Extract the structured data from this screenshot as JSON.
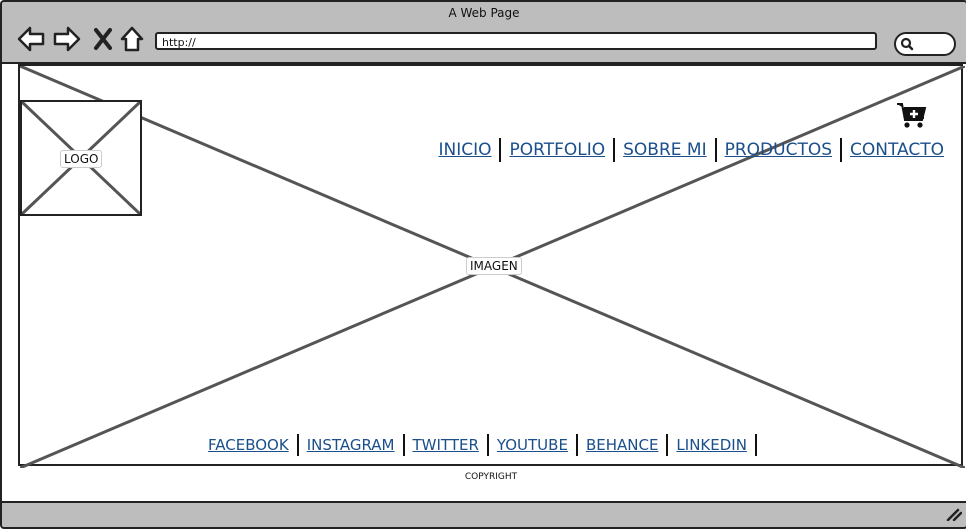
{
  "window": {
    "title": "A Web Page"
  },
  "toolbar": {
    "url": "http://",
    "back_icon": "back-arrow-icon",
    "forward_icon": "forward-arrow-icon",
    "stop_icon": "close-x-icon",
    "home_icon": "home-icon",
    "search_icon": "search-icon"
  },
  "page": {
    "logo_label": "LOGO",
    "hero_label": "IMAGEN",
    "cart_icon": "add-to-cart-icon",
    "nav": [
      "INICIO",
      "PORTFOLIO",
      "SOBRE MI",
      "PRODUCTOS",
      "CONTACTO"
    ],
    "social": [
      "FACEBOOK",
      "INSTAGRAM",
      "TWITTER",
      "YOUTUBE",
      "BEHANCE",
      "LINKEDIN"
    ],
    "copyright": "COPYRIGHT"
  },
  "colors": {
    "link": "#1a4f8c",
    "chrome": "#bdbdbd",
    "stroke": "#222222"
  }
}
